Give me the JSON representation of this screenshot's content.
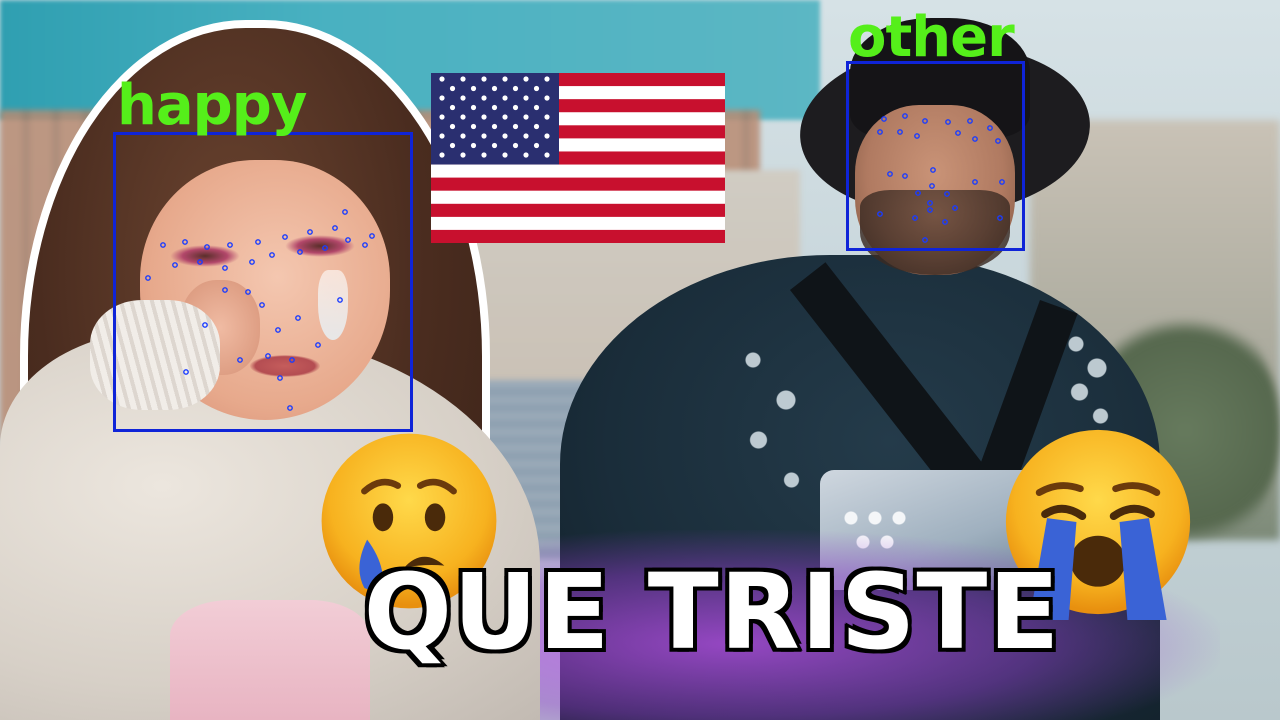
{
  "image": {
    "caption": "QUE TRISTE",
    "detections": [
      {
        "label": "happy",
        "box_color": "#0f24d8",
        "label_color": "#55ef1a"
      },
      {
        "label": "other",
        "box_color": "#0f24d8",
        "label_color": "#55ef1a"
      }
    ],
    "flag": "united-states-flag",
    "emojis": [
      "sad-but-relieved-face-emoji",
      "loudly-crying-face-emoji"
    ],
    "accent_colors": {
      "glow": "#be50f0",
      "caption_fill": "#ffffff",
      "caption_stroke": "#000000"
    }
  }
}
